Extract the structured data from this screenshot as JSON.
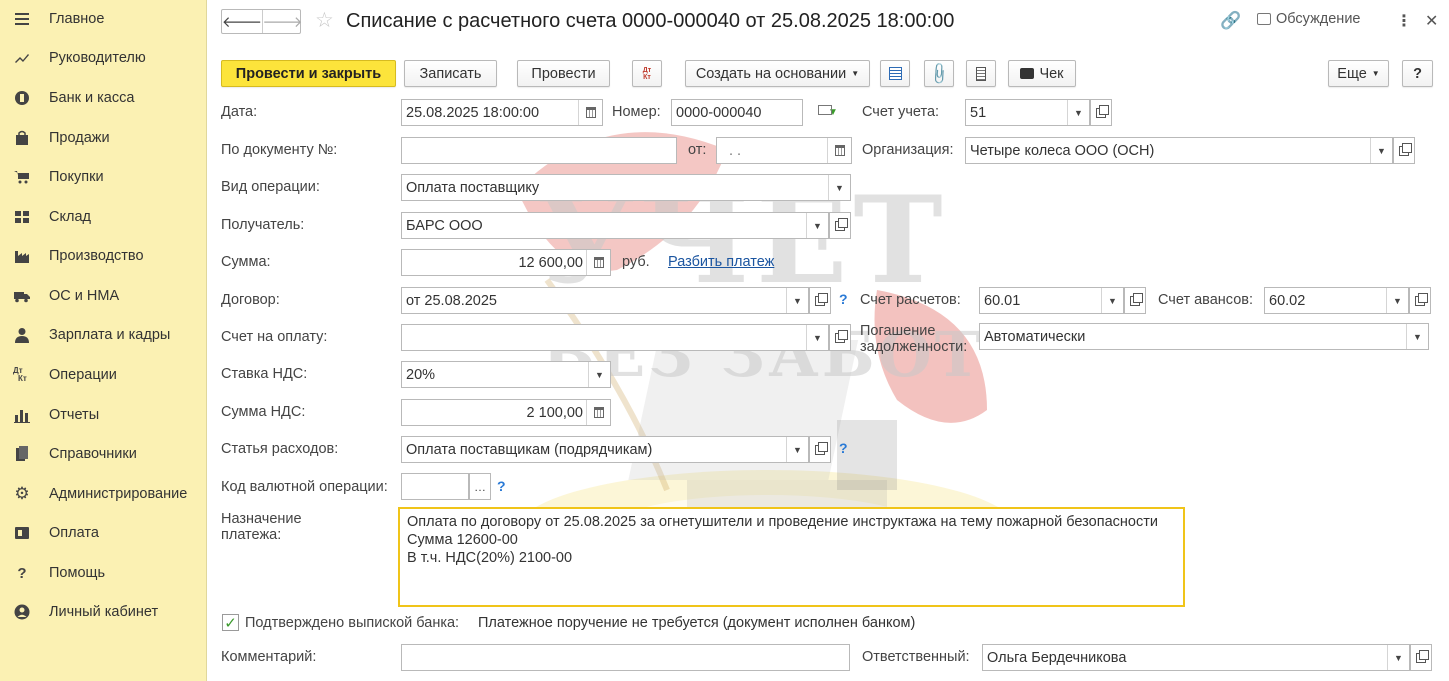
{
  "sidebar": {
    "items": [
      {
        "label": "Главное",
        "icon": "menu-icon"
      },
      {
        "label": "Руководителю",
        "icon": "trend-icon"
      },
      {
        "label": "Банк и касса",
        "icon": "coin-icon"
      },
      {
        "label": "Продажи",
        "icon": "bag-icon"
      },
      {
        "label": "Покупки",
        "icon": "cart-icon"
      },
      {
        "label": "Склад",
        "icon": "warehouse-icon"
      },
      {
        "label": "Производство",
        "icon": "factory-icon"
      },
      {
        "label": "ОС и НМА",
        "icon": "truck-icon"
      },
      {
        "label": "Зарплата и кадры",
        "icon": "person-icon"
      },
      {
        "label": "Операции",
        "icon": "dt-kt-icon"
      },
      {
        "label": "Отчеты",
        "icon": "bar-chart-icon"
      },
      {
        "label": "Справочники",
        "icon": "books-icon"
      },
      {
        "label": "Администрирование",
        "icon": "gear-icon"
      },
      {
        "label": "Оплата",
        "icon": "wallet-icon"
      },
      {
        "label": "Помощь",
        "icon": "question-icon"
      },
      {
        "label": "Личный кабинет",
        "icon": "user-circle-icon"
      }
    ]
  },
  "header": {
    "title": "Списание с расчетного счета 0000-000040 от 25.08.2025 18:00:00",
    "discussion": "Обсуждение"
  },
  "toolbar": {
    "post_close": "Провести и закрыть",
    "save": "Записать",
    "post": "Провести",
    "dt_kt": "Дт Кт",
    "create_based": "Создать на основании",
    "check": "Чек",
    "more": "Еще",
    "help": "?"
  },
  "form": {
    "date_label": "Дата:",
    "date_value": "25.08.2025 18:00:00",
    "number_label": "Номер:",
    "number_value": "0000-000040",
    "account_label": "Счет учета:",
    "account_value": "51",
    "doc_no_label": "По документу №:",
    "doc_no_value": "",
    "from_label": "от:",
    "from_value": " .  .",
    "org_label": "Организация:",
    "org_value": "Четыре колеса ООО (ОСН)",
    "op_type_label": "Вид операции:",
    "op_type_value": "Оплата поставщику",
    "recipient_label": "Получатель:",
    "recipient_value": "БАРС ООО",
    "sum_label": "Сумма:",
    "sum_value": "12 600,00",
    "currency": "руб.",
    "split_link": "Разбить платеж",
    "contract_label": "Договор:",
    "contract_value": "от 25.08.2025",
    "settle_acc_label": "Счет расчетов:",
    "settle_acc_value": "60.01",
    "advance_acc_label": "Счет авансов:",
    "advance_acc_value": "60.02",
    "invoice_label": "Счет на оплату:",
    "invoice_value": "",
    "repay_label_1": "Погашение",
    "repay_label_2": "задолженности:",
    "repay_value": "Автоматически",
    "vat_rate_label": "Ставка НДС:",
    "vat_rate_value": "20%",
    "vat_sum_label": "Сумма НДС:",
    "vat_sum_value": "2 100,00",
    "expense_label": "Статья расходов:",
    "expense_value": "Оплата поставщикам (подрядчикам)",
    "fx_code_label": "Код валютной операции:",
    "fx_code_value": "",
    "purpose_label_1": "Назначение",
    "purpose_label_2": "платежа:",
    "purpose_line_1": "Оплата по договору от 25.08.2025 за огнетушители и проведение инструктажа на тему пожарной безопасности",
    "purpose_line_2": "Сумма 12600-00",
    "purpose_line_3": "В т.ч. НДС(20%) 2100-00",
    "confirmed_label": "Подтверждено выпиской банка:",
    "confirmed_note": "Платежное поручение не требуется (документ исполнен банком)",
    "comment_label": "Комментарий:",
    "comment_value": "",
    "responsible_label": "Ответственный:",
    "responsible_value": "Ольга Бердечникова"
  },
  "watermark": {
    "line1": "УЧЕТ",
    "line2": "БЕЗ ЗАБОТ"
  },
  "colors": {
    "sidebar_bg": "#fbf1b3",
    "primary_button": "#fce43b",
    "textarea_border": "#f0c419",
    "link": "#1b55a0"
  }
}
